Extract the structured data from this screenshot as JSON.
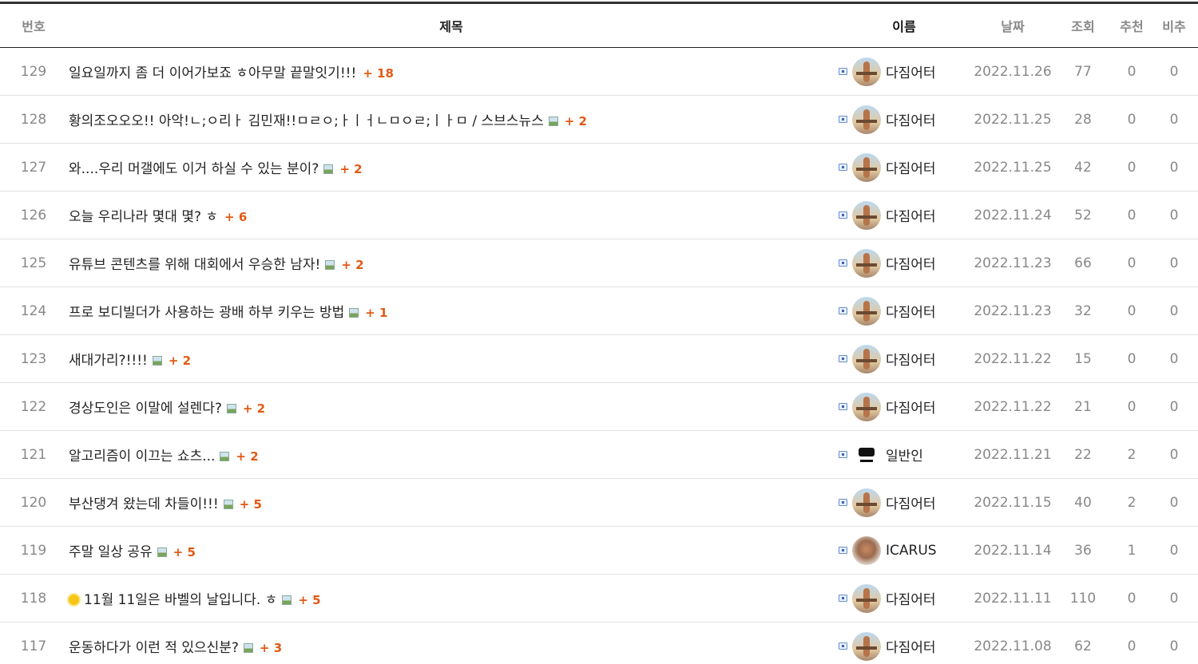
{
  "header": {
    "no": "번호",
    "subject": "제목",
    "name": "이름",
    "date": "날짜",
    "views": "조회",
    "recommend": "추천",
    "dislike": "비추"
  },
  "rows": [
    {
      "no": "129",
      "subject": "일요일까지 좀 더 이어가보죠 ㅎ아무말 끝말잇기!!!",
      "comments": "+ 18",
      "has_image": false,
      "emoji": false,
      "avatar": "gym",
      "name": "다짐어터",
      "date": "2022.11.26",
      "views": "77",
      "rec": "0",
      "dis": "0"
    },
    {
      "no": "128",
      "subject": "황의조오오오!! 아악!ㄴ;ㅇ리ㅏ 김민재!!ㅁㄹㅇ;ㅏㅣㅓㄴㅁㅇㄹ;ㅣㅏㅁ / 스브스뉴스",
      "comments": "+ 2",
      "has_image": true,
      "emoji": false,
      "avatar": "gym",
      "name": "다짐어터",
      "date": "2022.11.25",
      "views": "28",
      "rec": "0",
      "dis": "0"
    },
    {
      "no": "127",
      "subject": "와....우리 머갤에도 이거 하실 수 있는 분이?",
      "comments": "+ 2",
      "has_image": true,
      "emoji": false,
      "avatar": "gym",
      "name": "다짐어터",
      "date": "2022.11.25",
      "views": "42",
      "rec": "0",
      "dis": "0"
    },
    {
      "no": "126",
      "subject": "오늘 우리나라 몇대 몇? ㅎ",
      "comments": "+ 6",
      "has_image": false,
      "emoji": false,
      "avatar": "gym",
      "name": "다짐어터",
      "date": "2022.11.24",
      "views": "52",
      "rec": "0",
      "dis": "0"
    },
    {
      "no": "125",
      "subject": "유튜브 콘텐츠를 위해 대회에서 우승한 남자!",
      "comments": "+ 2",
      "has_image": true,
      "emoji": false,
      "avatar": "gym",
      "name": "다짐어터",
      "date": "2022.11.23",
      "views": "66",
      "rec": "0",
      "dis": "0"
    },
    {
      "no": "124",
      "subject": "프로 보디빌더가 사용하는 광배 하부 키우는 방법",
      "comments": "+ 1",
      "has_image": true,
      "emoji": false,
      "avatar": "gym",
      "name": "다짐어터",
      "date": "2022.11.23",
      "views": "32",
      "rec": "0",
      "dis": "0"
    },
    {
      "no": "123",
      "subject": "새대가리?!!!!",
      "comments": "+ 2",
      "has_image": true,
      "emoji": false,
      "avatar": "gym",
      "name": "다짐어터",
      "date": "2022.11.22",
      "views": "15",
      "rec": "0",
      "dis": "0"
    },
    {
      "no": "122",
      "subject": "경상도인은 이말에 설렌다?",
      "comments": "+ 2",
      "has_image": true,
      "emoji": false,
      "avatar": "gym",
      "name": "다짐어터",
      "date": "2022.11.22",
      "views": "21",
      "rec": "0",
      "dis": "0"
    },
    {
      "no": "121",
      "subject": "알고리즘이 이끄는 쇼츠...",
      "comments": "+ 2",
      "has_image": true,
      "emoji": false,
      "avatar": "logo",
      "name": "일반인",
      "date": "2022.11.21",
      "views": "22",
      "rec": "2",
      "dis": "0"
    },
    {
      "no": "120",
      "subject": "부산댕겨 왔는데 차들이!!!",
      "comments": "+ 5",
      "has_image": true,
      "emoji": false,
      "avatar": "gym",
      "name": "다짐어터",
      "date": "2022.11.15",
      "views": "40",
      "rec": "2",
      "dis": "0"
    },
    {
      "no": "119",
      "subject": "주말 일상 공유",
      "comments": "+ 5",
      "has_image": true,
      "emoji": false,
      "avatar": "body",
      "name": "ICARUS",
      "date": "2022.11.14",
      "views": "36",
      "rec": "1",
      "dis": "0"
    },
    {
      "no": "118",
      "subject": "11월 11일은 바벨의 날입니다. ㅎ",
      "comments": "+ 5",
      "has_image": true,
      "emoji": true,
      "avatar": "gym",
      "name": "다짐어터",
      "date": "2022.11.11",
      "views": "110",
      "rec": "0",
      "dis": "0"
    },
    {
      "no": "117",
      "subject": "운동하다가 이런 적 있으신분?",
      "comments": "+ 3",
      "has_image": true,
      "emoji": false,
      "avatar": "gym",
      "name": "다짐어터",
      "date": "2022.11.08",
      "views": "62",
      "rec": "0",
      "dis": "0"
    }
  ],
  "colors": {
    "comment_count": "#e05a14",
    "header_rule": "#222222",
    "row_border": "#e2e2e2"
  }
}
